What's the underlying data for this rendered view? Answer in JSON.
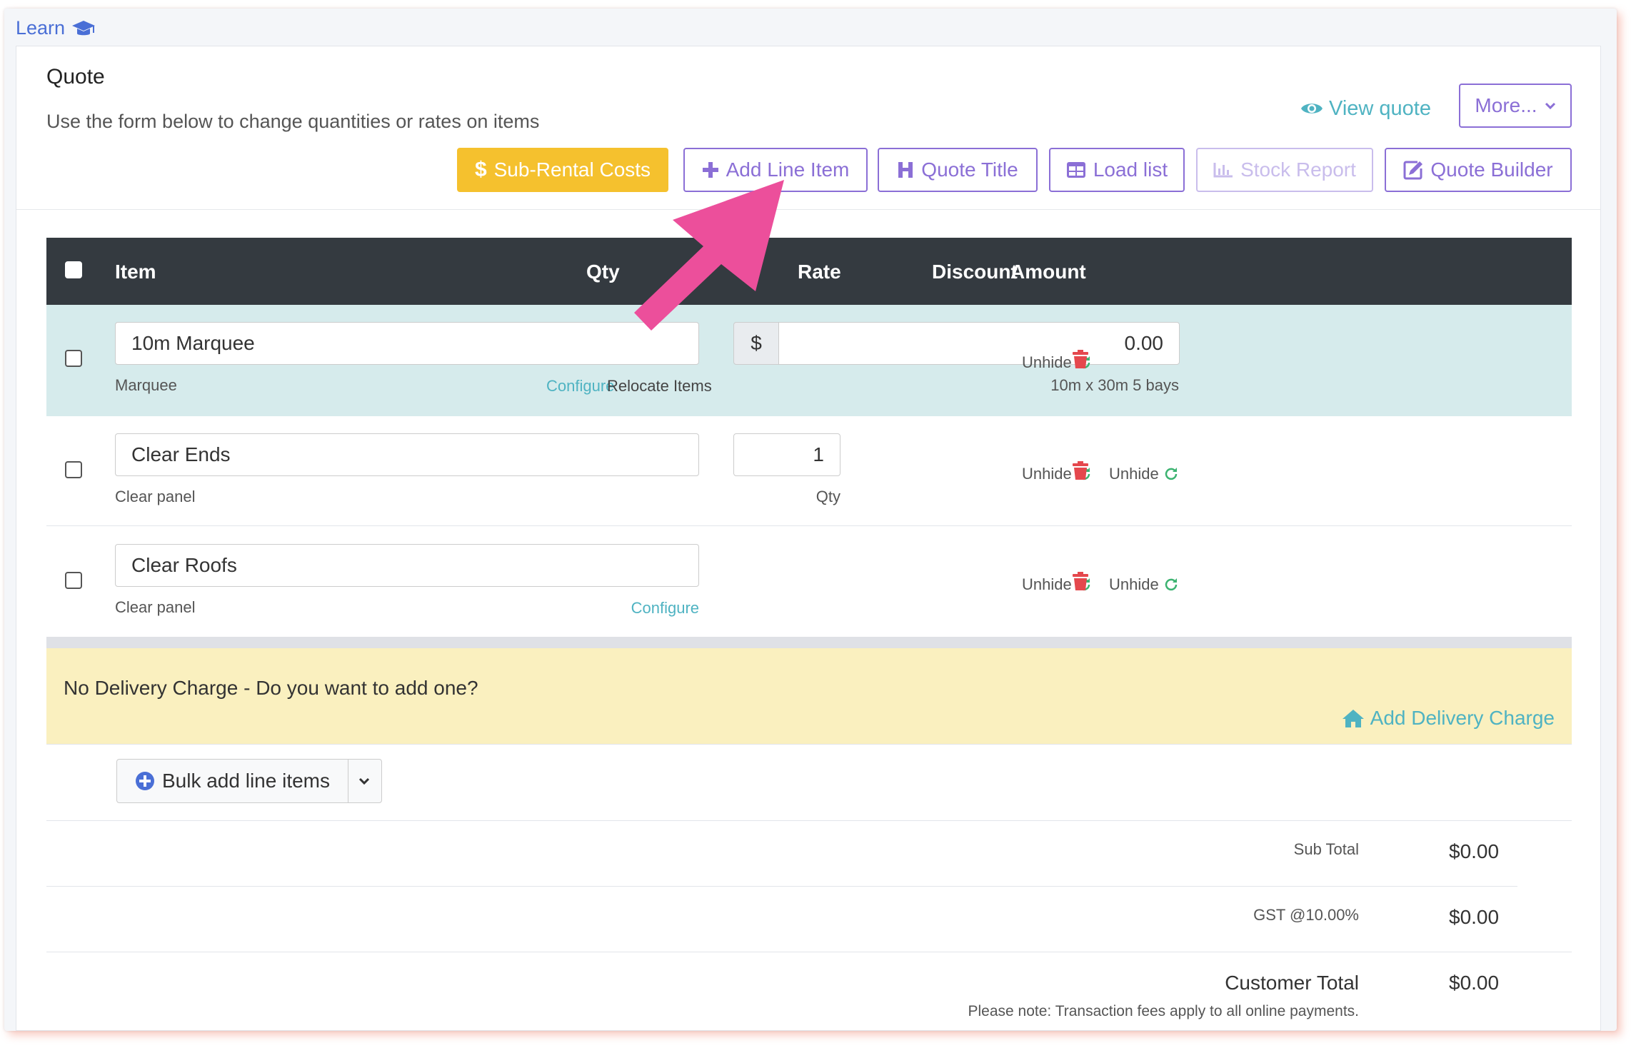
{
  "learn": {
    "label": "Learn"
  },
  "header": {
    "title": "Quote",
    "subtitle": "Use the form below to change quantities or rates on items",
    "view_quote": "View quote",
    "more": "More..."
  },
  "toolbar": {
    "sub_rental": "Sub-Rental Costs",
    "add_line_item": "Add Line Item",
    "quote_title": "Quote Title",
    "load_list": "Load list",
    "stock_report": "Stock Report",
    "quote_builder": "Quote Builder"
  },
  "table": {
    "columns": {
      "item": "Item",
      "qty": "Qty",
      "rate": "Rate",
      "discount": "Discount",
      "amount": "Amount"
    },
    "rows": [
      {
        "name": "10m Marquee",
        "category": "Marquee",
        "configure": "Configure",
        "relocate": "Relocate Items",
        "currency": "$",
        "rate": "0.00",
        "rate_note": "10m x 30m 5 bays",
        "amount_action": "Unhide"
      },
      {
        "name": "Clear Ends",
        "category": "Clear panel",
        "qty": "1",
        "qty_label": "Qty",
        "rate_action": "Unhide",
        "amount_action": "Unhide"
      },
      {
        "name": "Clear Roofs",
        "category": "Clear panel",
        "configure": "Configure",
        "rate_action": "Unhide",
        "amount_action": "Unhide"
      }
    ]
  },
  "delivery": {
    "message": "No Delivery Charge - Do you want to add one?",
    "add_label": "Add Delivery Charge"
  },
  "bulk": {
    "label": "Bulk add line items"
  },
  "totals": {
    "sub_total_label": "Sub Total",
    "sub_total": "$0.00",
    "gst_label": "GST @10.00%",
    "gst": "$0.00",
    "customer_total_label": "Customer Total",
    "customer_total": "$0.00",
    "note": "Please note: Transaction fees apply to all online payments."
  },
  "colors": {
    "accent": "#8b6fd6",
    "teal": "#4fb3c2",
    "warning": "#f5c12e",
    "danger": "#e5484d",
    "highlight_arrow": "#ec4f9b"
  },
  "icons": [
    "graduation-cap-icon",
    "eye-icon",
    "chevron-down-icon",
    "dollar-icon",
    "plus-icon",
    "heading-icon",
    "table-icon",
    "bar-chart-icon",
    "edit-icon",
    "refresh-icon",
    "trash-icon",
    "home-icon",
    "plus-circle-icon"
  ]
}
